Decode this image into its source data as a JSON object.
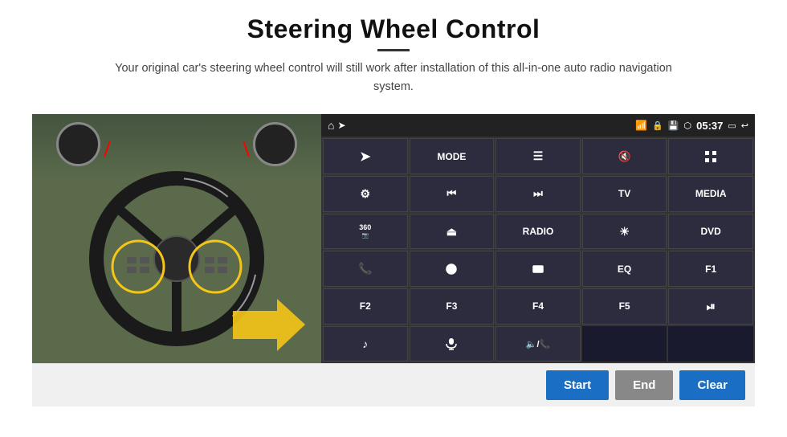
{
  "page": {
    "title": "Steering Wheel Control",
    "divider": true,
    "subtitle": "Your original car's steering wheel control will still work after installation of this all-in-one auto radio navigation system."
  },
  "status_bar": {
    "time": "05:37",
    "icons": [
      "wifi",
      "lock",
      "sd",
      "bluetooth",
      "screen",
      "back"
    ]
  },
  "grid_buttons": [
    {
      "id": "r1c1",
      "type": "icon",
      "label": "navigation-arrow",
      "char": "➤"
    },
    {
      "id": "r1c2",
      "type": "text",
      "label": "MODE"
    },
    {
      "id": "r1c3",
      "type": "icon",
      "label": "menu-list",
      "char": "☰"
    },
    {
      "id": "r1c4",
      "type": "icon",
      "label": "mute",
      "char": "🔇"
    },
    {
      "id": "r1c5",
      "type": "icon",
      "label": "grid-apps",
      "char": "⊞"
    },
    {
      "id": "r2c1",
      "type": "icon",
      "label": "settings-gear",
      "char": "⚙"
    },
    {
      "id": "r2c2",
      "type": "icon",
      "label": "rewind",
      "char": "⏮"
    },
    {
      "id": "r2c3",
      "type": "icon",
      "label": "fast-forward",
      "char": "⏭"
    },
    {
      "id": "r2c4",
      "type": "text",
      "label": "TV"
    },
    {
      "id": "r2c5",
      "type": "text",
      "label": "MEDIA"
    },
    {
      "id": "r3c1",
      "type": "icon",
      "label": "360-cam",
      "char": "360"
    },
    {
      "id": "r3c2",
      "type": "icon",
      "label": "eject",
      "char": "⏏"
    },
    {
      "id": "r3c3",
      "type": "text",
      "label": "RADIO"
    },
    {
      "id": "r3c4",
      "type": "icon",
      "label": "brightness",
      "char": "☀"
    },
    {
      "id": "r3c5",
      "type": "text",
      "label": "DVD"
    },
    {
      "id": "r4c1",
      "type": "icon",
      "label": "phone-call",
      "char": "📞"
    },
    {
      "id": "r4c2",
      "type": "icon",
      "label": "swirl-nav",
      "char": "◎"
    },
    {
      "id": "r4c3",
      "type": "icon",
      "label": "rectangle-box",
      "char": "▭"
    },
    {
      "id": "r4c4",
      "type": "text",
      "label": "EQ"
    },
    {
      "id": "r4c5",
      "type": "text",
      "label": "F1"
    },
    {
      "id": "r5c1",
      "type": "text",
      "label": "F2"
    },
    {
      "id": "r5c2",
      "type": "text",
      "label": "F3"
    },
    {
      "id": "r5c3",
      "type": "text",
      "label": "F4"
    },
    {
      "id": "r5c4",
      "type": "text",
      "label": "F5"
    },
    {
      "id": "r5c5",
      "type": "icon",
      "label": "play-pause",
      "char": "⏯"
    },
    {
      "id": "r6c1",
      "type": "icon",
      "label": "music-note",
      "char": "♪"
    },
    {
      "id": "r6c2",
      "type": "icon",
      "label": "microphone",
      "char": "🎤"
    },
    {
      "id": "r6c3",
      "type": "icon",
      "label": "volume-phone",
      "char": "🔈"
    }
  ],
  "bottom_bar": {
    "start_label": "Start",
    "end_label": "End",
    "clear_label": "Clear"
  }
}
